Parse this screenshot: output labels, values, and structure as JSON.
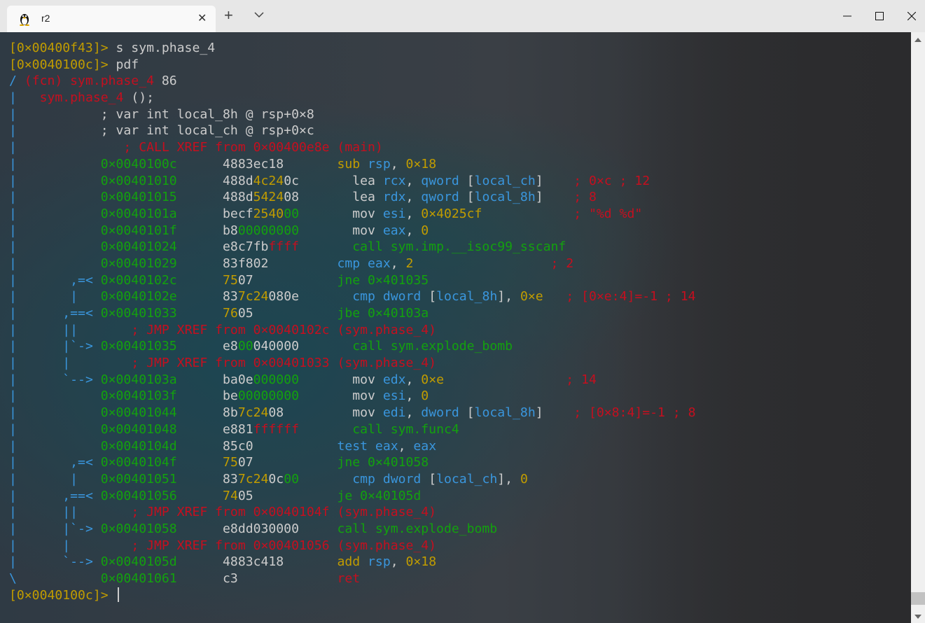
{
  "window": {
    "tab_title": "r2",
    "tab_icon": "linux-tux-icon",
    "new_tab_symbol": "+",
    "close_symbol": "✕"
  },
  "colors": {
    "prompt": "#c19c00",
    "text": "#cccccc",
    "red": "#c50f1f",
    "blue": "#3a96dd",
    "green": "#13a10e",
    "yellow": "#c19c00"
  },
  "terminal": {
    "lines": [
      [
        [
          "y",
          "[0×00400f43]>"
        ],
        [
          "w",
          " s sym.phase_4"
        ]
      ],
      [
        [
          "y",
          "[0×0040100c]>"
        ],
        [
          "w",
          " pdf"
        ]
      ],
      [
        [
          "b",
          "/ "
        ],
        [
          "r",
          "(fcn) sym.phase_4"
        ],
        [
          "w",
          " 86"
        ]
      ],
      [
        [
          "b",
          "|"
        ],
        [
          "w",
          "   "
        ],
        [
          "r",
          "sym.phase_4"
        ],
        [
          "w",
          " ();"
        ]
      ],
      [
        [
          "b",
          "|"
        ],
        [
          "w",
          "           ; var int local_8h @ rsp+0×8"
        ]
      ],
      [
        [
          "b",
          "|"
        ],
        [
          "w",
          "           ; var int local_ch @ rsp+0×c"
        ]
      ],
      [
        [
          "b",
          "|"
        ],
        [
          "r",
          "              ; CALL XREF from 0×00400e8e (main)"
        ]
      ],
      [
        [
          "b",
          "|"
        ],
        [
          "w",
          "           "
        ],
        [
          "g",
          "0×0040100c"
        ],
        [
          "w",
          "      4883ec18       "
        ],
        [
          "o",
          "sub"
        ],
        [
          "w",
          " "
        ],
        [
          "b",
          "rsp"
        ],
        [
          "w",
          ", "
        ],
        [
          "o",
          "0×18"
        ]
      ],
      [
        [
          "b",
          "|"
        ],
        [
          "w",
          "           "
        ],
        [
          "g",
          "0×00401010"
        ],
        [
          "w",
          "      488d"
        ],
        [
          "o",
          "4c24"
        ],
        [
          "w",
          "0c       lea "
        ],
        [
          "b",
          "rcx"
        ],
        [
          "w",
          ", "
        ],
        [
          "b",
          "qword"
        ],
        [
          "w",
          " ["
        ],
        [
          "b",
          "local_ch"
        ],
        [
          "w",
          "]    "
        ],
        [
          "r",
          "; 0×c ; 12"
        ]
      ],
      [
        [
          "b",
          "|"
        ],
        [
          "w",
          "           "
        ],
        [
          "g",
          "0×00401015"
        ],
        [
          "w",
          "      488d"
        ],
        [
          "o",
          "5424"
        ],
        [
          "w",
          "08       lea "
        ],
        [
          "b",
          "rdx"
        ],
        [
          "w",
          ", "
        ],
        [
          "b",
          "qword"
        ],
        [
          "w",
          " ["
        ],
        [
          "b",
          "local_8h"
        ],
        [
          "w",
          "]    "
        ],
        [
          "r",
          "; 8"
        ]
      ],
      [
        [
          "b",
          "|"
        ],
        [
          "w",
          "           "
        ],
        [
          "g",
          "0×0040101a"
        ],
        [
          "w",
          "      becf"
        ],
        [
          "o",
          "2540"
        ],
        [
          "g",
          "00"
        ],
        [
          "w",
          "       mov "
        ],
        [
          "b",
          "esi"
        ],
        [
          "w",
          ", "
        ],
        [
          "o",
          "0×4025cf"
        ],
        [
          "w",
          "            "
        ],
        [
          "r",
          "; \"%d %d\""
        ]
      ],
      [
        [
          "b",
          "|"
        ],
        [
          "w",
          "           "
        ],
        [
          "g",
          "0×0040101f"
        ],
        [
          "w",
          "      b8"
        ],
        [
          "g",
          "00000000"
        ],
        [
          "w",
          "       mov "
        ],
        [
          "b",
          "eax"
        ],
        [
          "w",
          ", "
        ],
        [
          "o",
          "0"
        ]
      ],
      [
        [
          "b",
          "|"
        ],
        [
          "w",
          "           "
        ],
        [
          "g",
          "0×00401024"
        ],
        [
          "w",
          "      e8c7fb"
        ],
        [
          "r",
          "ffff"
        ],
        [
          "w",
          "       "
        ],
        [
          "g",
          "call sym.imp.__isoc99_sscanf"
        ]
      ],
      [
        [
          "b",
          "|"
        ],
        [
          "w",
          "           "
        ],
        [
          "g",
          "0×00401029"
        ],
        [
          "w",
          "      83f802         "
        ],
        [
          "b",
          "cmp"
        ],
        [
          "w",
          " "
        ],
        [
          "b",
          "eax"
        ],
        [
          "w",
          ", "
        ],
        [
          "o",
          "2"
        ],
        [
          "w",
          "                  "
        ],
        [
          "r",
          "; 2"
        ]
      ],
      [
        [
          "b",
          "|"
        ],
        [
          "b",
          "       ,=< "
        ],
        [
          "g",
          "0×0040102c"
        ],
        [
          "w",
          "      "
        ],
        [
          "o",
          "75"
        ],
        [
          "w",
          "07           "
        ],
        [
          "g",
          "jne 0×401035"
        ]
      ],
      [
        [
          "b",
          "|"
        ],
        [
          "b",
          "       |   "
        ],
        [
          "g",
          "0×0040102e"
        ],
        [
          "w",
          "      83"
        ],
        [
          "o",
          "7c24"
        ],
        [
          "w",
          "080e       "
        ],
        [
          "b",
          "cmp"
        ],
        [
          "w",
          " "
        ],
        [
          "b",
          "dword"
        ],
        [
          "w",
          " ["
        ],
        [
          "b",
          "local_8h"
        ],
        [
          "w",
          "], "
        ],
        [
          "o",
          "0×e"
        ],
        [
          "w",
          "   "
        ],
        [
          "r",
          "; [0×e:4]=-1 ; 14"
        ]
      ],
      [
        [
          "b",
          "|"
        ],
        [
          "b",
          "      ,==< "
        ],
        [
          "g",
          "0×00401033"
        ],
        [
          "w",
          "      "
        ],
        [
          "o",
          "76"
        ],
        [
          "w",
          "05           "
        ],
        [
          "g",
          "jbe 0×40103a"
        ]
      ],
      [
        [
          "b",
          "|"
        ],
        [
          "b",
          "      ||"
        ],
        [
          "r",
          "       ; JMP XREF from 0×0040102c (sym.phase_4)"
        ]
      ],
      [
        [
          "b",
          "|"
        ],
        [
          "b",
          "      |`-> "
        ],
        [
          "g",
          "0×00401035"
        ],
        [
          "w",
          "      e8"
        ],
        [
          "g",
          "00"
        ],
        [
          "w",
          "040000       "
        ],
        [
          "g",
          "call sym.explode_bomb"
        ]
      ],
      [
        [
          "b",
          "|"
        ],
        [
          "b",
          "      |"
        ],
        [
          "r",
          "        ; JMP XREF from 0×00401033 (sym.phase_4)"
        ]
      ],
      [
        [
          "b",
          "|"
        ],
        [
          "b",
          "      `--> "
        ],
        [
          "g",
          "0×0040103a"
        ],
        [
          "w",
          "      ba0e"
        ],
        [
          "g",
          "000000"
        ],
        [
          "w",
          "       mov "
        ],
        [
          "b",
          "edx"
        ],
        [
          "w",
          ", "
        ],
        [
          "o",
          "0×e"
        ],
        [
          "w",
          "                "
        ],
        [
          "r",
          "; 14"
        ]
      ],
      [
        [
          "b",
          "|"
        ],
        [
          "w",
          "           "
        ],
        [
          "g",
          "0×0040103f"
        ],
        [
          "w",
          "      be"
        ],
        [
          "g",
          "00000000"
        ],
        [
          "w",
          "       mov "
        ],
        [
          "b",
          "esi"
        ],
        [
          "w",
          ", "
        ],
        [
          "o",
          "0"
        ]
      ],
      [
        [
          "b",
          "|"
        ],
        [
          "w",
          "           "
        ],
        [
          "g",
          "0×00401044"
        ],
        [
          "w",
          "      8b"
        ],
        [
          "o",
          "7c24"
        ],
        [
          "w",
          "08         mov "
        ],
        [
          "b",
          "edi"
        ],
        [
          "w",
          ", "
        ],
        [
          "b",
          "dword"
        ],
        [
          "w",
          " ["
        ],
        [
          "b",
          "local_8h"
        ],
        [
          "w",
          "]    "
        ],
        [
          "r",
          "; [0×8:4]=-1 ; 8"
        ]
      ],
      [
        [
          "b",
          "|"
        ],
        [
          "w",
          "           "
        ],
        [
          "g",
          "0×00401048"
        ],
        [
          "w",
          "      e881"
        ],
        [
          "r",
          "ffffff"
        ],
        [
          "w",
          "       "
        ],
        [
          "g",
          "call sym.func4"
        ]
      ],
      [
        [
          "b",
          "|"
        ],
        [
          "w",
          "           "
        ],
        [
          "g",
          "0×0040104d"
        ],
        [
          "w",
          "      85c0           "
        ],
        [
          "b",
          "test"
        ],
        [
          "w",
          " "
        ],
        [
          "b",
          "eax"
        ],
        [
          "w",
          ", "
        ],
        [
          "b",
          "eax"
        ]
      ],
      [
        [
          "b",
          "|"
        ],
        [
          "b",
          "       ,=< "
        ],
        [
          "g",
          "0×0040104f"
        ],
        [
          "w",
          "      "
        ],
        [
          "o",
          "75"
        ],
        [
          "w",
          "07           "
        ],
        [
          "g",
          "jne 0×401058"
        ]
      ],
      [
        [
          "b",
          "|"
        ],
        [
          "b",
          "       |   "
        ],
        [
          "g",
          "0×00401051"
        ],
        [
          "w",
          "      83"
        ],
        [
          "o",
          "7c24"
        ],
        [
          "w",
          "0c"
        ],
        [
          "g",
          "00"
        ],
        [
          "w",
          "       "
        ],
        [
          "b",
          "cmp"
        ],
        [
          "w",
          " "
        ],
        [
          "b",
          "dword"
        ],
        [
          "w",
          " ["
        ],
        [
          "b",
          "local_ch"
        ],
        [
          "w",
          "], "
        ],
        [
          "o",
          "0"
        ]
      ],
      [
        [
          "b",
          "|"
        ],
        [
          "b",
          "      ,==< "
        ],
        [
          "g",
          "0×00401056"
        ],
        [
          "w",
          "      "
        ],
        [
          "o",
          "74"
        ],
        [
          "w",
          "05           "
        ],
        [
          "g",
          "je 0×40105d"
        ]
      ],
      [
        [
          "b",
          "|"
        ],
        [
          "b",
          "      ||"
        ],
        [
          "r",
          "       ; JMP XREF from 0×0040104f (sym.phase_4)"
        ]
      ],
      [
        [
          "b",
          "|"
        ],
        [
          "b",
          "      |`-> "
        ],
        [
          "g",
          "0×00401058"
        ],
        [
          "w",
          "      e8dd030000     "
        ],
        [
          "g",
          "call sym.explode_bomb"
        ]
      ],
      [
        [
          "b",
          "|"
        ],
        [
          "b",
          "      |"
        ],
        [
          "r",
          "        ; JMP XREF from 0×00401056 (sym.phase_4)"
        ]
      ],
      [
        [
          "b",
          "|"
        ],
        [
          "b",
          "      `--> "
        ],
        [
          "g",
          "0×0040105d"
        ],
        [
          "w",
          "      4883c418       "
        ],
        [
          "o",
          "add"
        ],
        [
          "w",
          " "
        ],
        [
          "b",
          "rsp"
        ],
        [
          "w",
          ", "
        ],
        [
          "o",
          "0×18"
        ]
      ],
      [
        [
          "b",
          "\\"
        ],
        [
          "w",
          "           "
        ],
        [
          "g",
          "0×00401061"
        ],
        [
          "w",
          "      c3             "
        ],
        [
          "r",
          "ret"
        ]
      ],
      [
        [
          "y",
          "[0×0040100c]>"
        ],
        [
          "w",
          " "
        ]
      ]
    ]
  }
}
